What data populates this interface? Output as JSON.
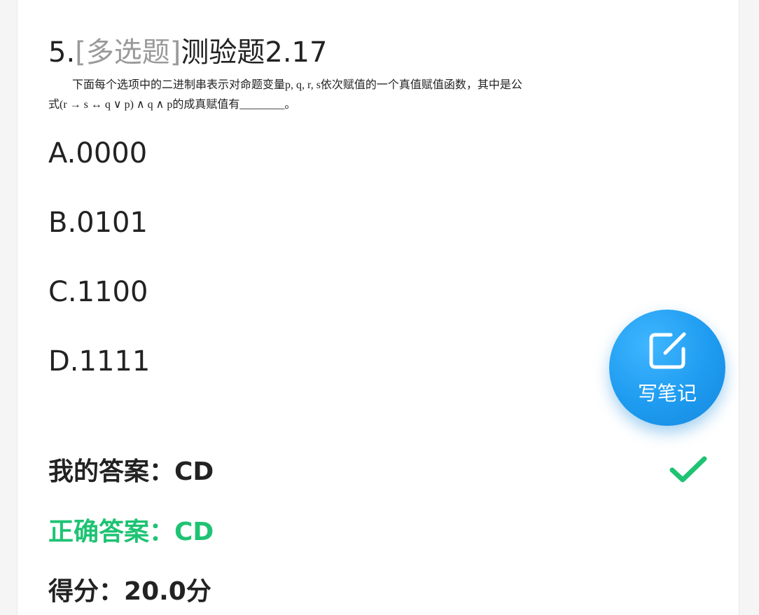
{
  "question": {
    "number": "5.",
    "type": "[多选题]",
    "title": "测验题2.17",
    "body_line1": "下面每个选项中的二进制串表示对命题变量p, q, r, s依次赋值的一个真值赋值函数，其中是公",
    "body_line2": "式(r → s ↔ q ∨ p) ∧ q ∧ p的成真赋值有________。"
  },
  "options": [
    {
      "label": "A.0000"
    },
    {
      "label": "B.0101"
    },
    {
      "label": "C.1100"
    },
    {
      "label": "D.1111"
    }
  ],
  "result": {
    "my_answer_label": "我的答案：",
    "my_answer": "CD",
    "correct_label": "正确答案：",
    "correct_answer": "CD",
    "score_label": "得分：",
    "score": "20.0分",
    "status_icon": "check-icon",
    "correct_color": "#1ec373"
  },
  "fab": {
    "label": "写笔记",
    "icon": "edit-note-icon",
    "color": "#1e9bf0"
  }
}
